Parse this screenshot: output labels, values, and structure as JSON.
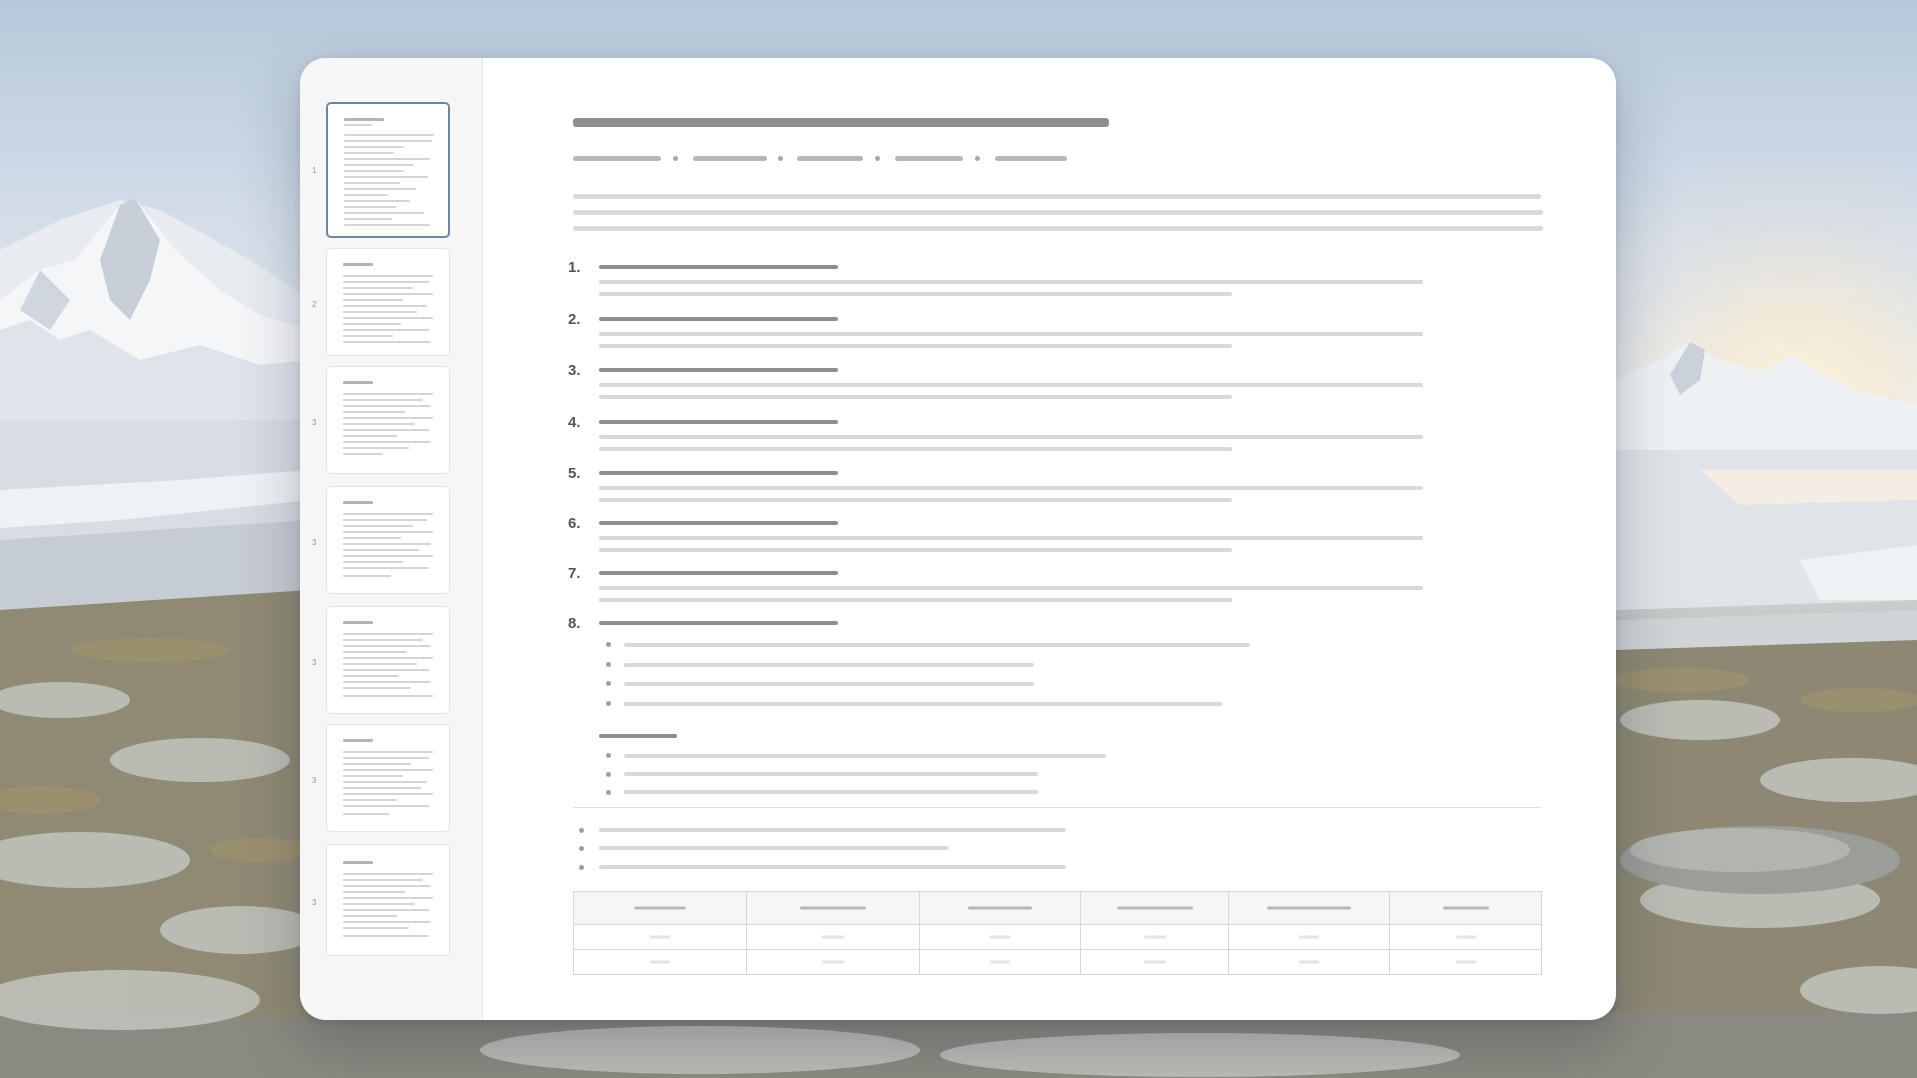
{
  "thumbnails": [
    {
      "page": "1",
      "active": true
    },
    {
      "page": "2",
      "active": false
    },
    {
      "page": "3",
      "active": false
    },
    {
      "page": "3",
      "active": false
    },
    {
      "page": "3",
      "active": false
    },
    {
      "page": "3",
      "active": false
    },
    {
      "page": "3",
      "active": false
    }
  ],
  "outline": {
    "numbers": [
      "1.",
      "2.",
      "3.",
      "4.",
      "5.",
      "6.",
      "7.",
      "8."
    ]
  },
  "table": {
    "columns": 6,
    "rows": 2
  }
}
